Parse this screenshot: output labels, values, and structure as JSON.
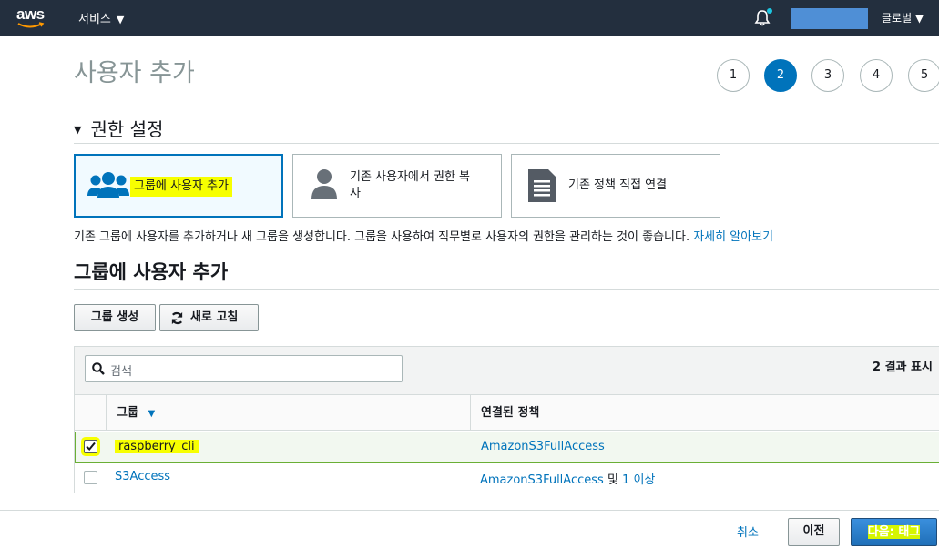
{
  "nav": {
    "logo_text": "aws",
    "services_label": "서비스",
    "region_label": "글로벌 ▼"
  },
  "header": {
    "title": "사용자 추가",
    "steps": [
      "1",
      "2",
      "3",
      "4",
      "5"
    ],
    "active_step": "2"
  },
  "permissions": {
    "section_title": "권한 설정",
    "options": [
      {
        "label": "그룹에 사용자 추가",
        "icon": "users-group-icon",
        "selected": true
      },
      {
        "label_line1": "기존 사용자에서 권한 복",
        "label_line2": "사",
        "icon": "user-icon",
        "selected": false
      },
      {
        "label": "기존 정책 직접 연결",
        "icon": "document-icon",
        "selected": false
      }
    ],
    "description": "기존 그룹에 사용자를 추가하거나 새 그룹을 생성합니다. 그룹을 사용하여 직무별로 사용자의 권한을 관리하는 것이 좋습니다.",
    "learn_more": "자세히 알아보기"
  },
  "groups": {
    "title": "그룹에 사용자 추가",
    "create_button": "그룹 생성",
    "refresh_button": "새로 고침",
    "search_placeholder": "검색",
    "result_count": "2 결과 표시",
    "columns": [
      "그룹",
      "연결된 정책"
    ],
    "rows": [
      {
        "group": "raspberry_cli",
        "policy": "AmazonS3FullAccess",
        "extra_joiner": "",
        "extra_link": "",
        "checked": true
      },
      {
        "group": "S3Access",
        "policy": "AmazonS3FullAccess",
        "extra_joiner": "및",
        "extra_link": "1 이상",
        "checked": false
      }
    ]
  },
  "footer": {
    "cancel": "취소",
    "previous": "이전",
    "next": "다음: 태그"
  },
  "colors": {
    "nav_bg": "#232f3e",
    "accent": "#0073bb",
    "highlight": "#f7ff00"
  }
}
